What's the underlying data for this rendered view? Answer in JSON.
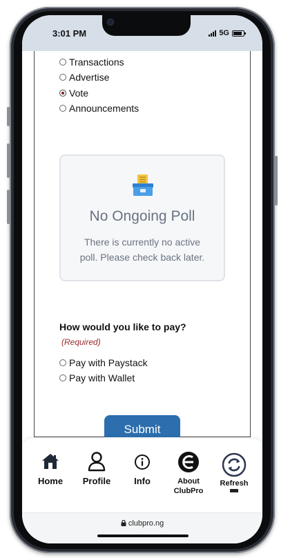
{
  "status": {
    "time": "3:01 PM",
    "network": "5G"
  },
  "menu": {
    "options": [
      {
        "label": "Transactions",
        "selected": false
      },
      {
        "label": "Advertise",
        "selected": false
      },
      {
        "label": "Vote",
        "selected": true
      },
      {
        "label": "Announcements",
        "selected": false
      }
    ]
  },
  "poll": {
    "icon": "ballot-box-icon",
    "title": "No Ongoing Poll",
    "message": "There is currently no active poll. Please check back later."
  },
  "payment": {
    "question": "How would you like to pay?",
    "required": "(Required)",
    "options": [
      {
        "label": "Pay with Paystack",
        "selected": false
      },
      {
        "label": "Pay with Wallet",
        "selected": false
      }
    ]
  },
  "form": {
    "submit_label": "Submit"
  },
  "bottom_nav": {
    "home": {
      "label": "Home",
      "icon": "home-icon"
    },
    "profile": {
      "label": "Profile",
      "icon": "user-icon"
    },
    "info": {
      "label": "Info",
      "icon": "info-icon"
    },
    "about": {
      "label": "About ClubPro",
      "line1": "About",
      "line2": "ClubPro",
      "icon": "clubpro-logo-icon"
    },
    "refresh": {
      "label": "Refresh",
      "icon": "refresh-icon"
    }
  },
  "browser": {
    "url": "clubpro.ng",
    "lock_icon": "lock-icon"
  },
  "colors": {
    "status_bar_bg": "#d6dee7",
    "submit_bg": "#2c6eae",
    "required_text": "#9a2a2a",
    "radio_selected": "#7b1c1c",
    "muted_text": "#6b7280"
  }
}
